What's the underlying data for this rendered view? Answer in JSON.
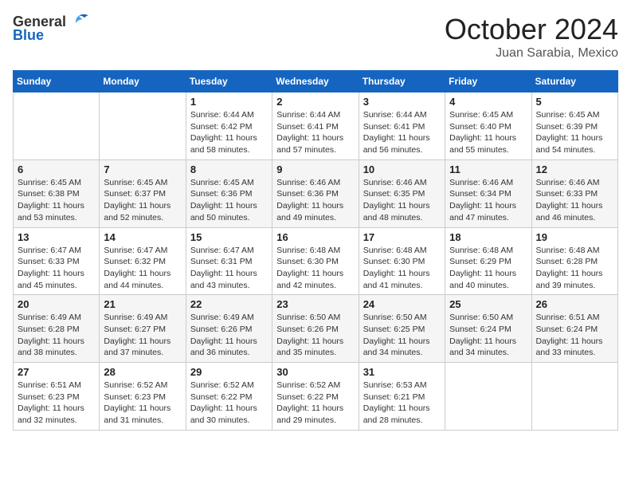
{
  "logo": {
    "general": "General",
    "blue": "Blue"
  },
  "title": "October 2024",
  "location": "Juan Sarabia, Mexico",
  "weekdays": [
    "Sunday",
    "Monday",
    "Tuesday",
    "Wednesday",
    "Thursday",
    "Friday",
    "Saturday"
  ],
  "weeks": [
    [
      {
        "day": "",
        "info": ""
      },
      {
        "day": "",
        "info": ""
      },
      {
        "day": "1",
        "info": "Sunrise: 6:44 AM\nSunset: 6:42 PM\nDaylight: 11 hours and 58 minutes."
      },
      {
        "day": "2",
        "info": "Sunrise: 6:44 AM\nSunset: 6:41 PM\nDaylight: 11 hours and 57 minutes."
      },
      {
        "day": "3",
        "info": "Sunrise: 6:44 AM\nSunset: 6:41 PM\nDaylight: 11 hours and 56 minutes."
      },
      {
        "day": "4",
        "info": "Sunrise: 6:45 AM\nSunset: 6:40 PM\nDaylight: 11 hours and 55 minutes."
      },
      {
        "day": "5",
        "info": "Sunrise: 6:45 AM\nSunset: 6:39 PM\nDaylight: 11 hours and 54 minutes."
      }
    ],
    [
      {
        "day": "6",
        "info": "Sunrise: 6:45 AM\nSunset: 6:38 PM\nDaylight: 11 hours and 53 minutes."
      },
      {
        "day": "7",
        "info": "Sunrise: 6:45 AM\nSunset: 6:37 PM\nDaylight: 11 hours and 52 minutes."
      },
      {
        "day": "8",
        "info": "Sunrise: 6:45 AM\nSunset: 6:36 PM\nDaylight: 11 hours and 50 minutes."
      },
      {
        "day": "9",
        "info": "Sunrise: 6:46 AM\nSunset: 6:36 PM\nDaylight: 11 hours and 49 minutes."
      },
      {
        "day": "10",
        "info": "Sunrise: 6:46 AM\nSunset: 6:35 PM\nDaylight: 11 hours and 48 minutes."
      },
      {
        "day": "11",
        "info": "Sunrise: 6:46 AM\nSunset: 6:34 PM\nDaylight: 11 hours and 47 minutes."
      },
      {
        "day": "12",
        "info": "Sunrise: 6:46 AM\nSunset: 6:33 PM\nDaylight: 11 hours and 46 minutes."
      }
    ],
    [
      {
        "day": "13",
        "info": "Sunrise: 6:47 AM\nSunset: 6:33 PM\nDaylight: 11 hours and 45 minutes."
      },
      {
        "day": "14",
        "info": "Sunrise: 6:47 AM\nSunset: 6:32 PM\nDaylight: 11 hours and 44 minutes."
      },
      {
        "day": "15",
        "info": "Sunrise: 6:47 AM\nSunset: 6:31 PM\nDaylight: 11 hours and 43 minutes."
      },
      {
        "day": "16",
        "info": "Sunrise: 6:48 AM\nSunset: 6:30 PM\nDaylight: 11 hours and 42 minutes."
      },
      {
        "day": "17",
        "info": "Sunrise: 6:48 AM\nSunset: 6:30 PM\nDaylight: 11 hours and 41 minutes."
      },
      {
        "day": "18",
        "info": "Sunrise: 6:48 AM\nSunset: 6:29 PM\nDaylight: 11 hours and 40 minutes."
      },
      {
        "day": "19",
        "info": "Sunrise: 6:48 AM\nSunset: 6:28 PM\nDaylight: 11 hours and 39 minutes."
      }
    ],
    [
      {
        "day": "20",
        "info": "Sunrise: 6:49 AM\nSunset: 6:28 PM\nDaylight: 11 hours and 38 minutes."
      },
      {
        "day": "21",
        "info": "Sunrise: 6:49 AM\nSunset: 6:27 PM\nDaylight: 11 hours and 37 minutes."
      },
      {
        "day": "22",
        "info": "Sunrise: 6:49 AM\nSunset: 6:26 PM\nDaylight: 11 hours and 36 minutes."
      },
      {
        "day": "23",
        "info": "Sunrise: 6:50 AM\nSunset: 6:26 PM\nDaylight: 11 hours and 35 minutes."
      },
      {
        "day": "24",
        "info": "Sunrise: 6:50 AM\nSunset: 6:25 PM\nDaylight: 11 hours and 34 minutes."
      },
      {
        "day": "25",
        "info": "Sunrise: 6:50 AM\nSunset: 6:24 PM\nDaylight: 11 hours and 34 minutes."
      },
      {
        "day": "26",
        "info": "Sunrise: 6:51 AM\nSunset: 6:24 PM\nDaylight: 11 hours and 33 minutes."
      }
    ],
    [
      {
        "day": "27",
        "info": "Sunrise: 6:51 AM\nSunset: 6:23 PM\nDaylight: 11 hours and 32 minutes."
      },
      {
        "day": "28",
        "info": "Sunrise: 6:52 AM\nSunset: 6:23 PM\nDaylight: 11 hours and 31 minutes."
      },
      {
        "day": "29",
        "info": "Sunrise: 6:52 AM\nSunset: 6:22 PM\nDaylight: 11 hours and 30 minutes."
      },
      {
        "day": "30",
        "info": "Sunrise: 6:52 AM\nSunset: 6:22 PM\nDaylight: 11 hours and 29 minutes."
      },
      {
        "day": "31",
        "info": "Sunrise: 6:53 AM\nSunset: 6:21 PM\nDaylight: 11 hours and 28 minutes."
      },
      {
        "day": "",
        "info": ""
      },
      {
        "day": "",
        "info": ""
      }
    ]
  ]
}
